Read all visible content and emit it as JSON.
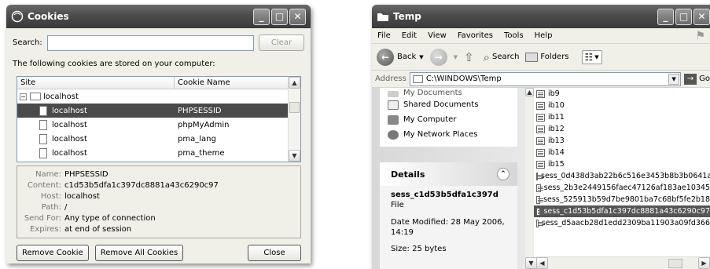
{
  "cookies_window": {
    "title": "Cookies",
    "search_label": "Search:",
    "search_value": "",
    "clear_label": "Clear",
    "intro_text": "The following cookies are stored on your computer:",
    "columns": [
      "Site",
      "Cookie Name"
    ],
    "group": "localhost",
    "rows": [
      {
        "site": "localhost",
        "cookie": "PHPSESSID"
      },
      {
        "site": "localhost",
        "cookie": "phpMyAdmin"
      },
      {
        "site": "localhost",
        "cookie": "pma_lang"
      },
      {
        "site": "localhost",
        "cookie": "pma_theme"
      }
    ],
    "details": {
      "name_label": "Name:",
      "name": "PHPSESSID",
      "content_label": "Content:",
      "content": "c1d53b5dfa1c397dc8881a43c6290c97",
      "host_label": "Host:",
      "host": "localhost",
      "path_label": "Path:",
      "path": "/",
      "sendfor_label": "Send For:",
      "sendfor": "Any type of connection",
      "expires_label": "Expires:",
      "expires": "at end of session"
    },
    "buttons": {
      "remove": "Remove Cookie",
      "remove_all": "Remove All Cookies",
      "close": "Close"
    }
  },
  "temp_window": {
    "title": "Temp",
    "menu": [
      "File",
      "Edit",
      "View",
      "Favorites",
      "Tools",
      "Help"
    ],
    "toolbar": {
      "back": "Back",
      "search": "Search",
      "folders": "Folders"
    },
    "address_label": "Address",
    "address_value": "C:\\WINDOWS\\Temp",
    "go_label": "Go",
    "places": [
      "My Documents",
      "Shared Documents",
      "My Computer",
      "My Network Places"
    ],
    "details_title": "Details",
    "details_name": "sess_c1d53b5dfa1c397d",
    "details_type": "File",
    "details_modified": "Date Modified: 28 May 2006, 14:19",
    "details_size": "Size: 25 bytes",
    "files": [
      "ib9",
      "ib10",
      "ib11",
      "ib12",
      "ib13",
      "ib14",
      "ib15",
      "sess_0d438d3ab22b6c516e3453b8b3b0641a",
      "sess_2b3e2449156faec47126af183ae10345",
      "sess_525913b59d7be9801ba7c68bf5fe2b18",
      "sess_c1d53b5dfa1c397dc8881a43c6290c97",
      "sess_d5aacb28d1edd2309ba11903a09fd366"
    ]
  }
}
